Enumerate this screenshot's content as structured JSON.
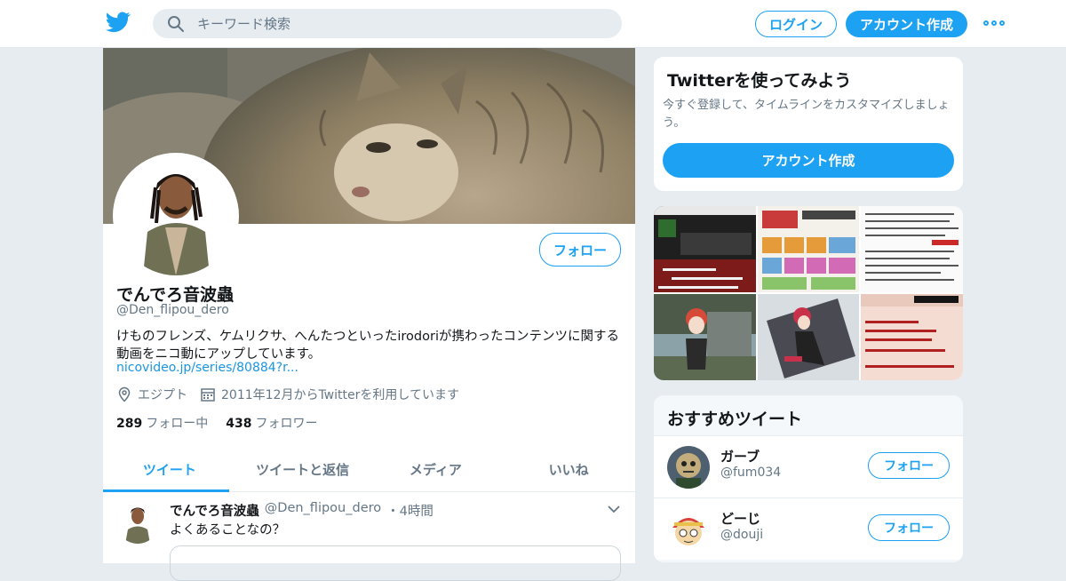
{
  "header": {
    "logo_icon": "twitter-bird-icon",
    "search_placeholder": "キーワード検索",
    "login_label": "ログイン",
    "signup_label": "アカウント作成",
    "more_icon": "more-dots-icon",
    "accent": "#1da1f2"
  },
  "profile": {
    "name": "でんでろ音波蟲",
    "handle": "@Den_flipou_dero",
    "follow_label": "フォロー",
    "bio": "けものフレンズ、ケムリクサ、へんたつといったirodoriが携わったコンテンツに関する動画をニコ動にアップしています。",
    "link": "nicovideo.jp/series/80884?r...",
    "location": "エジプト",
    "joined": "2011年12月からTwitterを利用しています",
    "following_count": "289",
    "following_label": "フォロー中",
    "followers_count": "438",
    "followers_label": "フォロワー"
  },
  "tabs": [
    {
      "label": "ツイート"
    },
    {
      "label": "ツイートと返信"
    },
    {
      "label": "メディア"
    },
    {
      "label": "いいね"
    }
  ],
  "tweet": {
    "name": "でんでろ音波蟲",
    "handle": "@Den_flipou_dero",
    "time": "・4時間",
    "text": "よくあることなの？"
  },
  "sidebar": {
    "signup_title": "Twitterを使ってみよう",
    "signup_text": "今すぐ登録して、タイムラインをカスタマイズしましょう。",
    "signup_button": "アカウント作成",
    "recs_title": "おすすめツイート",
    "recs": [
      {
        "name": "ガーブ",
        "handle": "@fum034",
        "follow_label": "フォロー"
      },
      {
        "name": "どーじ",
        "handle": "@douji",
        "follow_label": "フォロー"
      }
    ]
  }
}
